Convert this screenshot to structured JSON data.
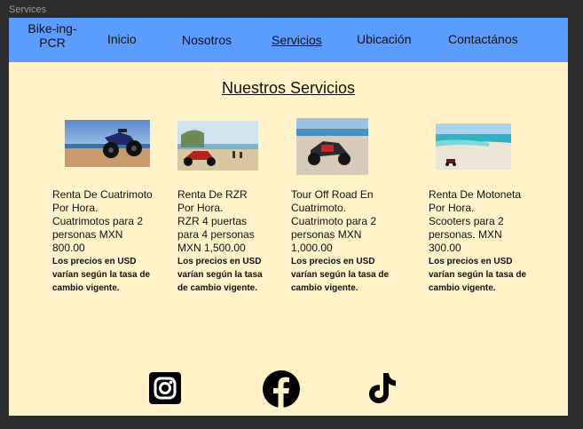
{
  "window": {
    "frame_label": "Services"
  },
  "nav": {
    "logo_line1": "Bike-ing-",
    "logo_line2": "PCR",
    "items": [
      "Inicio",
      "Nosotros",
      "Servicios",
      "Ubicación",
      "Contactános"
    ],
    "active": "Servicios"
  },
  "page": {
    "title": "Nuestros Servicios"
  },
  "services": [
    {
      "line1": "Renta De Cuatrimoto",
      "line2": "Por Hora.",
      "line3": "Cuatrimotos para 2",
      "line4": "personas MXN",
      "line5": "800.00",
      "note": "Los precios en USD varían según la tasa de cambio vigente."
    },
    {
      "line1": "Renta De RZR",
      "line2": "Por Hora.",
      "line3": "RZR 4 puertas",
      "line4": "para 4 personas",
      "line5": "MXN 1,500.00",
      "note": "Los precios en USD varían según la tasa de cambio vigente."
    },
    {
      "line1": "Tour Off Road En",
      "line2": "Cuatrimoto.",
      "line3": "Cuatrimoto para 2",
      "line4": "personas MXN",
      "line5": "1,000.00",
      "note": "Los precios en USD varían según la tasa de cambio vigente."
    },
    {
      "line1": "Renta De Motoneta",
      "line2": "Por Hora.",
      "line3": "Scooters para 2",
      "line4": "personas. MXN",
      "line5": "300.00",
      "note": "Los precios en USD varían según la tasa de cambio vigente."
    }
  ],
  "social": {
    "icons": [
      "instagram-icon",
      "facebook-icon",
      "tiktok-icon"
    ]
  },
  "colors": {
    "navbar": "#5b9cff",
    "page_bg": "#fff2c8",
    "canvas_bg": "#2c2c2c"
  }
}
